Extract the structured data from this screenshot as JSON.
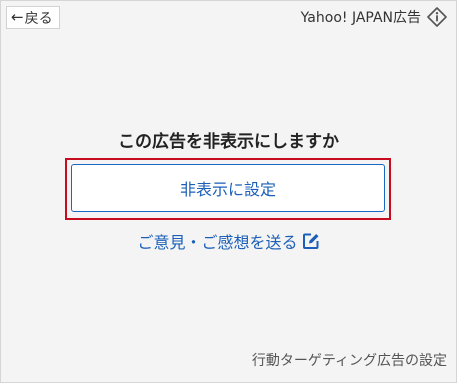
{
  "header": {
    "back_label": "戻る",
    "sponsor_label": "Yahoo! JAPAN広告",
    "back_icon": "left-arrow-icon",
    "info_icon": "info-diamond-icon"
  },
  "dialog": {
    "question": "この広告を非表示にしますか",
    "hide_button_label": "非表示に設定",
    "feedback_label": "ご意見・ご感想を送る",
    "feedback_icon": "edit-icon"
  },
  "footer": {
    "targeting_settings_label": "行動ターゲティング広告の設定"
  },
  "colors": {
    "panel_background": "#f4f4f4",
    "link_blue": "#1b5fb8",
    "highlight_red": "#c80c1f"
  }
}
